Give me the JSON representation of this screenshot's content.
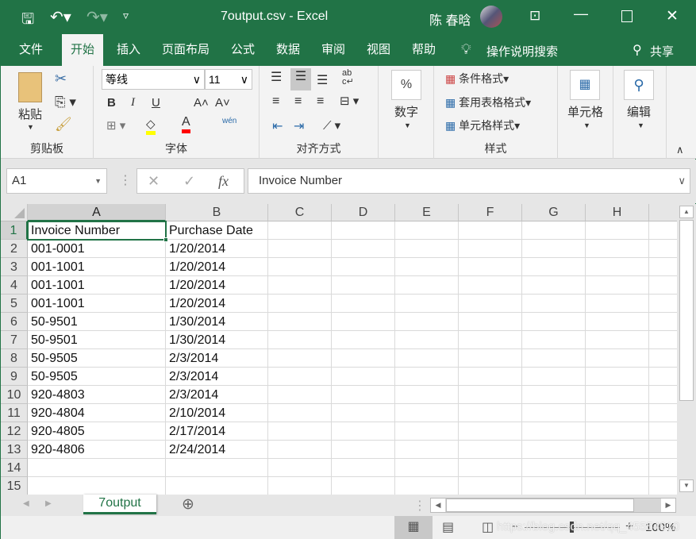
{
  "titlebar": {
    "title": "7output.csv  -  Excel",
    "user": "陈 春晗",
    "qat": [
      "save-icon",
      "undo-icon",
      "redo-icon",
      "customize-icon"
    ],
    "controls": [
      "ribbon-display-icon",
      "minimize-icon",
      "maximize-icon",
      "close-icon"
    ]
  },
  "tabs": [
    "文件",
    "开始",
    "插入",
    "页面布局",
    "公式",
    "数据",
    "审阅",
    "视图",
    "帮助"
  ],
  "active_tab": "开始",
  "tell_me": "操作说明搜索",
  "share": "共享",
  "ribbon": {
    "clipboard": {
      "label": "剪贴板",
      "paste": "粘贴"
    },
    "font": {
      "label": "字体",
      "font_name": "等线",
      "font_size": "11",
      "bold": "B",
      "italic": "I",
      "underline": "U",
      "highlight_color": "#ffff00",
      "font_color": "#ff0000",
      "phonetic": "wén"
    },
    "alignment": {
      "label": "对齐方式",
      "wrap": "ab c↵"
    },
    "number": {
      "label": "数字",
      "symbol": "%"
    },
    "styles": {
      "label": "样式",
      "items": [
        "条件格式",
        "套用表格格式",
        "单元格样式"
      ]
    },
    "cells": {
      "label": "单元格"
    },
    "editing": {
      "label": "编辑"
    }
  },
  "formula_bar": {
    "name_box": "A1",
    "cancel": "✕",
    "enter": "✓",
    "fx": "fx",
    "value": "Invoice Number"
  },
  "columns": [
    "A",
    "B",
    "C",
    "D",
    "E",
    "F",
    "G",
    "H"
  ],
  "rows": [
    [
      "Invoice Number",
      "Purchase Date"
    ],
    [
      "001-0001",
      "1/20/2014"
    ],
    [
      "001-1001",
      "1/20/2014"
    ],
    [
      "001-1001",
      "1/20/2014"
    ],
    [
      "001-1001",
      "1/20/2014"
    ],
    [
      "50-9501",
      "1/30/2014"
    ],
    [
      "50-9501",
      "1/30/2014"
    ],
    [
      "50-9505",
      "2/3/2014"
    ],
    [
      "50-9505",
      "2/3/2014"
    ],
    [
      "920-4803",
      "2/3/2014"
    ],
    [
      "920-4804",
      "2/10/2014"
    ],
    [
      "920-4805",
      "2/17/2014"
    ],
    [
      "920-4806",
      "2/24/2014"
    ],
    [
      "",
      ""
    ],
    [
      "",
      ""
    ]
  ],
  "row_numbers": [
    "1",
    "2",
    "3",
    "4",
    "5",
    "6",
    "7",
    "8",
    "9",
    "10",
    "11",
    "12",
    "13",
    "14",
    "15"
  ],
  "selected_cell": "A1",
  "sheet_tabs": [
    "7output"
  ],
  "status": {
    "zoom": "100%",
    "zoom_minus": "−",
    "zoom_plus": "+"
  },
  "watermark": "https://blog.csdn.net/qq_45554910",
  "colors": {
    "accent": "#217346"
  }
}
